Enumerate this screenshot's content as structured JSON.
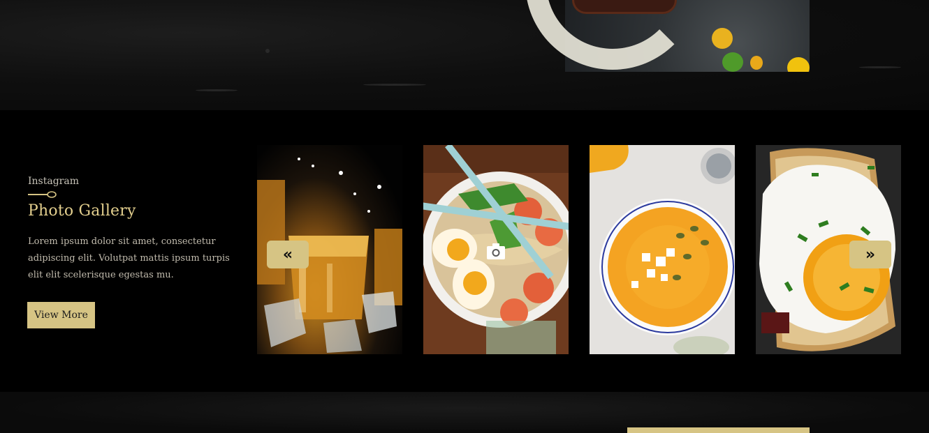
{
  "gallery": {
    "eyebrow": "Instagram",
    "title": "Photo Gallery",
    "description": "Lorem ipsum dolor sit amet, consectetur adipiscing elit. Volutpat mattis ipsum turpis elit elit scelerisque egestas mu.",
    "button_label": "View More",
    "prev_icon": "double-chevron-left-icon",
    "next_icon": "double-chevron-right-icon",
    "prev_glyph": "«",
    "next_glyph": "»",
    "overlay_icon": "camera-icon",
    "tiles": [
      {
        "subject": "whiskey-glass"
      },
      {
        "subject": "ramen-bowl"
      },
      {
        "subject": "pumpkin-soup"
      },
      {
        "subject": "fried-egg-toast"
      }
    ]
  },
  "colors": {
    "accent_gold": "#d6c484",
    "title_gold": "#e3cf8e",
    "band_black": "#000000",
    "muted_text": "#c2bcae"
  }
}
